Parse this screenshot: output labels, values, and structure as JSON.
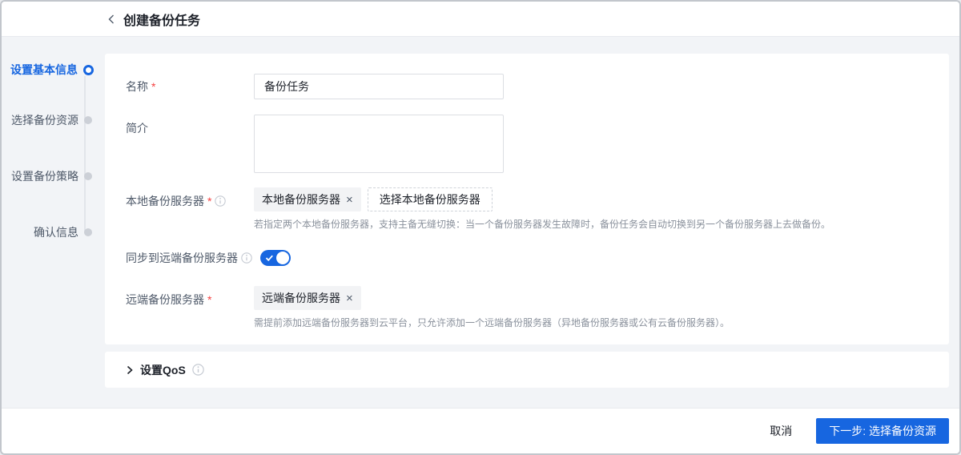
{
  "header": {
    "title": "创建备份任务"
  },
  "steps": [
    {
      "label": "设置基本信息",
      "state": "active"
    },
    {
      "label": "选择备份资源",
      "state": "pending"
    },
    {
      "label": "设置备份策略",
      "state": "pending"
    },
    {
      "label": "确认信息",
      "state": "pending"
    }
  ],
  "form": {
    "required_marker": "*",
    "name": {
      "label": "名称",
      "value": "备份任务"
    },
    "description": {
      "label": "简介",
      "value": ""
    },
    "local_server": {
      "label": "本地备份服务器",
      "tag_label": "本地备份服务器",
      "select_button_label": "选择本地备份服务器",
      "hint": "若指定两个本地备份服务器，支持主备无缝切换：当一个备份服务器发生故障时，备份任务会自动切换到另一个备份服务器上去做备份。"
    },
    "sync_remote": {
      "label": "同步到远端备份服务器",
      "state": "on"
    },
    "remote_server": {
      "label": "远端备份服务器",
      "tag_label": "远端备份服务器",
      "hint": "需提前添加远端备份服务器到云平台，只允许添加一个远端备份服务器（异地备份服务器或公有云备份服务器）。"
    }
  },
  "qos": {
    "label": "设置QoS"
  },
  "footer": {
    "cancel_label": "取消",
    "next_label": "下一步: 选择备份资源"
  },
  "icons": {
    "remove": "×"
  },
  "colors": {
    "primary": "#1766E0",
    "required": "#F53F3F",
    "hint": "#8A919C",
    "background": "#F2F4F7"
  }
}
